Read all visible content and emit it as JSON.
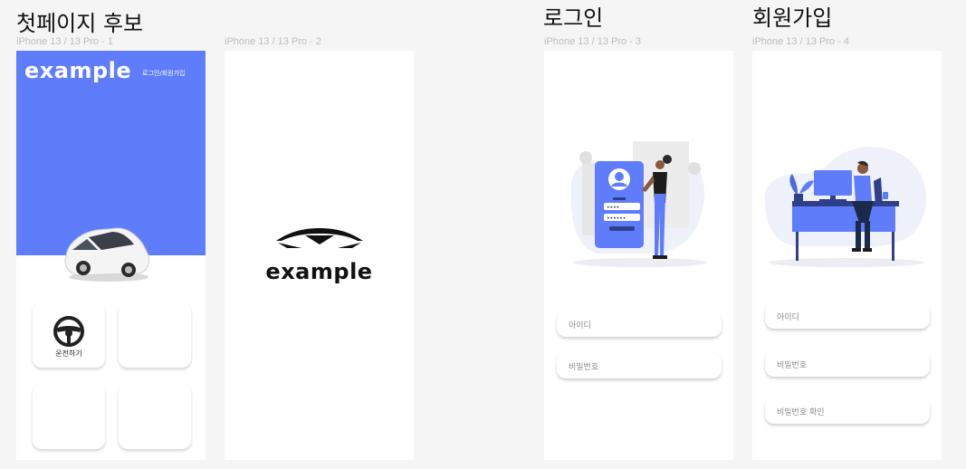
{
  "sections": {
    "first_page": "첫페이지 후보",
    "login": "로그인",
    "signup": "회원가입"
  },
  "frames": {
    "f1": "iPhone 13 / 13 Pro - 1",
    "f2": "iPhone 13 / 13 Pro - 2",
    "f3": "iPhone 13 / 13 Pro - 3",
    "f4": "iPhone 13 / 13 Pro - 4"
  },
  "home": {
    "logo": "example",
    "login_link": "로그인/회원가입",
    "tiles": [
      {
        "label": "운전하기",
        "icon": "steering-wheel-icon"
      },
      {
        "label": ""
      },
      {
        "label": ""
      },
      {
        "label": ""
      }
    ]
  },
  "splash": {
    "logo": "example"
  },
  "login": {
    "id_placeholder": "아이디",
    "pw_placeholder": "비밀번호"
  },
  "signup": {
    "id_placeholder": "아이디",
    "pw_placeholder": "비밀번호",
    "pw_confirm_placeholder": "비밀번호 확인"
  },
  "colors": {
    "primary": "#5f7dfa",
    "background": "#f5f5f5"
  }
}
